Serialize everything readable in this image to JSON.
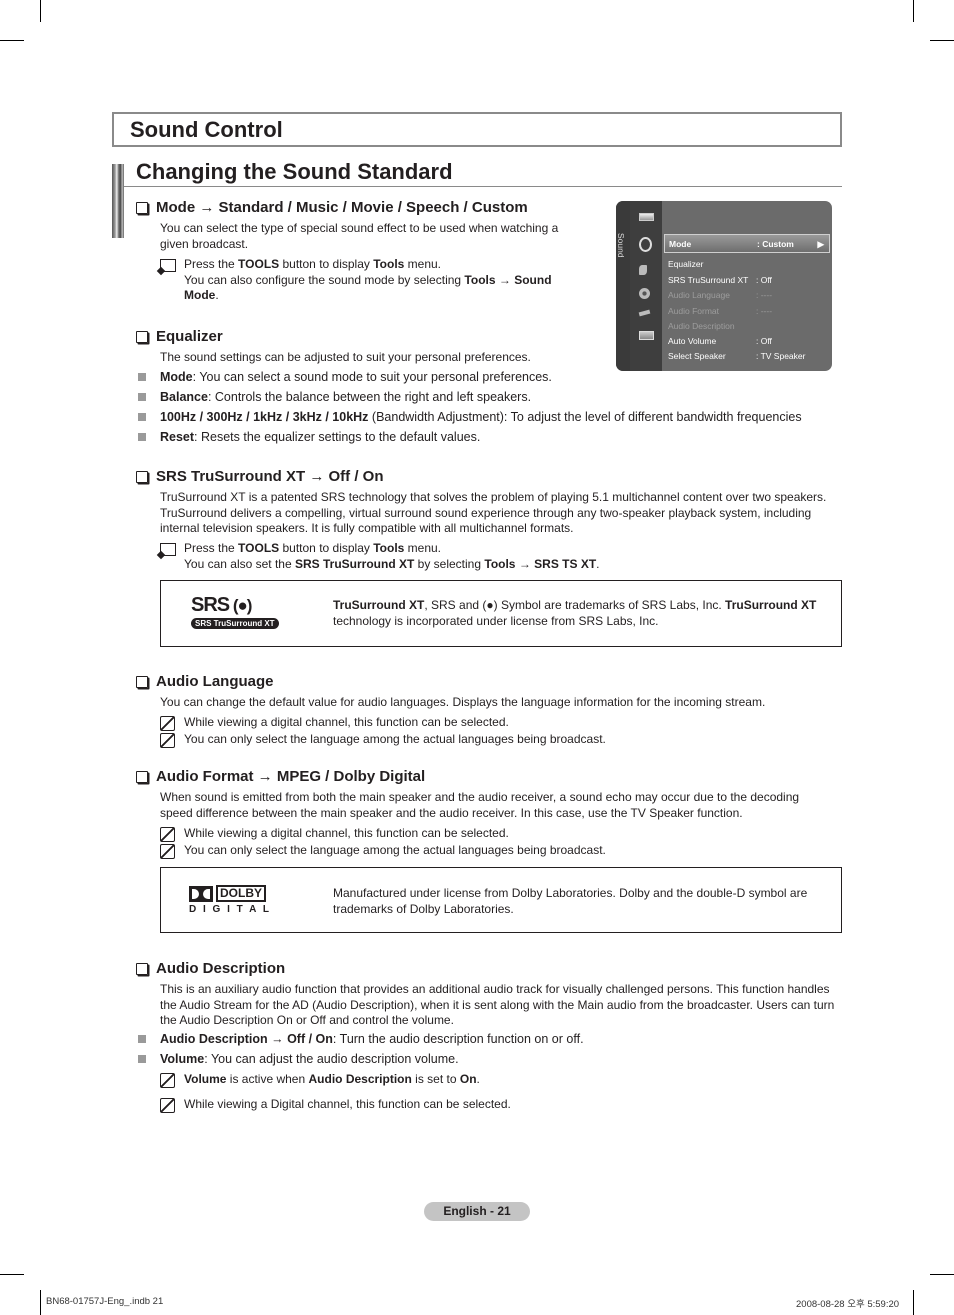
{
  "section_title": "Sound Control",
  "subsection_title": "Changing the Sound Standard",
  "mode": {
    "heading": "Mode → Standard / Music / Movie / Speech / Custom",
    "body": "You can select the type of special sound effect to be used when watching a given broadcast.",
    "tools_line1_a": "Press the ",
    "tools_line1_b": "TOOLS",
    "tools_line1_c": " button to display ",
    "tools_line1_d": "Tools",
    "tools_line1_e": " menu.",
    "tools_line2_a": "You can also configure the sound mode by selecting ",
    "tools_line2_b": "Tools → Sound Mode",
    "tools_line2_c": "."
  },
  "osd_menu": {
    "side_label": "Sound",
    "items": [
      {
        "label": "Mode",
        "value": ": Custom",
        "state": "selected",
        "arrow": "▶"
      },
      {
        "label": "Equalizer",
        "value": "",
        "state": "normal"
      },
      {
        "label": "SRS TruSurround XT",
        "value": ": Off",
        "state": "normal"
      },
      {
        "label": "Audio Language",
        "value": ": ----",
        "state": "disabled"
      },
      {
        "label": "Audio Format",
        "value": ": ----",
        "state": "disabled"
      },
      {
        "label": "Audio Description",
        "value": "",
        "state": "disabled"
      },
      {
        "label": "Auto Volume",
        "value": ": Off",
        "state": "normal"
      },
      {
        "label": "Select Speaker",
        "value": ": TV Speaker",
        "state": "normal"
      }
    ]
  },
  "equalizer": {
    "heading": "Equalizer",
    "body": "The sound settings can be adjusted to suit your personal preferences.",
    "bullets": [
      {
        "term": "Mode",
        "text": ": You can select a sound mode to suit your personal preferences."
      },
      {
        "term": "Balance",
        "text": ": Controls the balance between the right and left speakers."
      },
      {
        "term": "100Hz / 300Hz / 1kHz / 3kHz / 10kHz",
        "text": " (Bandwidth Adjustment): To adjust the level of different bandwidth frequencies"
      },
      {
        "term": "Reset",
        "text": ": Resets the equalizer settings to the default values."
      }
    ]
  },
  "srs": {
    "heading": "SRS TruSurround XT → Off / On",
    "body": "TruSurround XT is a patented SRS technology that solves the problem of playing 5.1 multichannel content over two speakers. TruSurround delivers a compelling, virtual surround sound experience through any two-speaker playback system, including internal television speakers. It is fully compatible with all multichannel formats.",
    "tools_line1_a": "Press the ",
    "tools_line1_b": "TOOLS",
    "tools_line1_c": " button to display ",
    "tools_line1_d": "Tools",
    "tools_line1_e": " menu.",
    "tools_line2_a": "You can also set the ",
    "tools_line2_b": "SRS TruSurround XT",
    "tools_line2_c": " by selecting ",
    "tools_line2_d": "Tools → SRS TS XT",
    "tools_line2_e": ".",
    "logo_top": "SRS",
    "logo_bottom": "SRS TruSurround XT",
    "trademark_a": "TruSurround XT",
    "trademark_b": ", SRS and (●) Symbol are trademarks of SRS Labs, Inc. ",
    "trademark_c": "TruSurround XT",
    "trademark_d": " technology is incorporated under license from SRS Labs, Inc."
  },
  "audio_language": {
    "heading": "Audio Language",
    "body": "You can change the default value for audio languages. Displays the language information for the incoming stream.",
    "notes": [
      "While viewing a digital channel, this function can be selected.",
      "You can only select the language among the actual languages being broadcast."
    ]
  },
  "audio_format": {
    "heading": "Audio Format → MPEG / Dolby Digital",
    "body": "When sound is emitted from both the main speaker and the audio receiver, a sound echo may occur due to the decoding speed difference between the main speaker and the audio receiver. In this case, use the TV Speaker function.",
    "notes": [
      "While viewing a digital channel, this function can be selected.",
      "You can only select the language among the actual languages being broadcast."
    ],
    "logo_word": "DOLBY",
    "logo_sub": "D I G I T A L",
    "trademark": "Manufactured under license from Dolby Laboratories. Dolby and the double-D symbol are trademarks of Dolby Laboratories."
  },
  "audio_description": {
    "heading": "Audio Description",
    "body": "This is an auxiliary audio function that provides an additional audio track for visually challenged persons. This function handles the Audio Stream for the AD (Audio Description), when it is sent along with the Main audio from the broadcaster. Users can turn the Audio Description On or Off and control the volume.",
    "bullets": [
      {
        "term": "Audio Description → Off / On",
        "text": ": Turn the audio description function on or off."
      },
      {
        "term": "Volume",
        "text": ": You can adjust the audio description volume."
      }
    ],
    "note1_a": "Volume",
    "note1_b": " is active when ",
    "note1_c": "Audio Description",
    "note1_d": " is set to ",
    "note1_e": "On",
    "note1_f": ".",
    "note2": "While viewing a Digital channel, this function can be selected."
  },
  "footer": {
    "page_label": "English - 21",
    "file": "BN68-01757J-Eng_.indb   21",
    "timestamp": "2008-08-28   오후 5:59:20"
  }
}
